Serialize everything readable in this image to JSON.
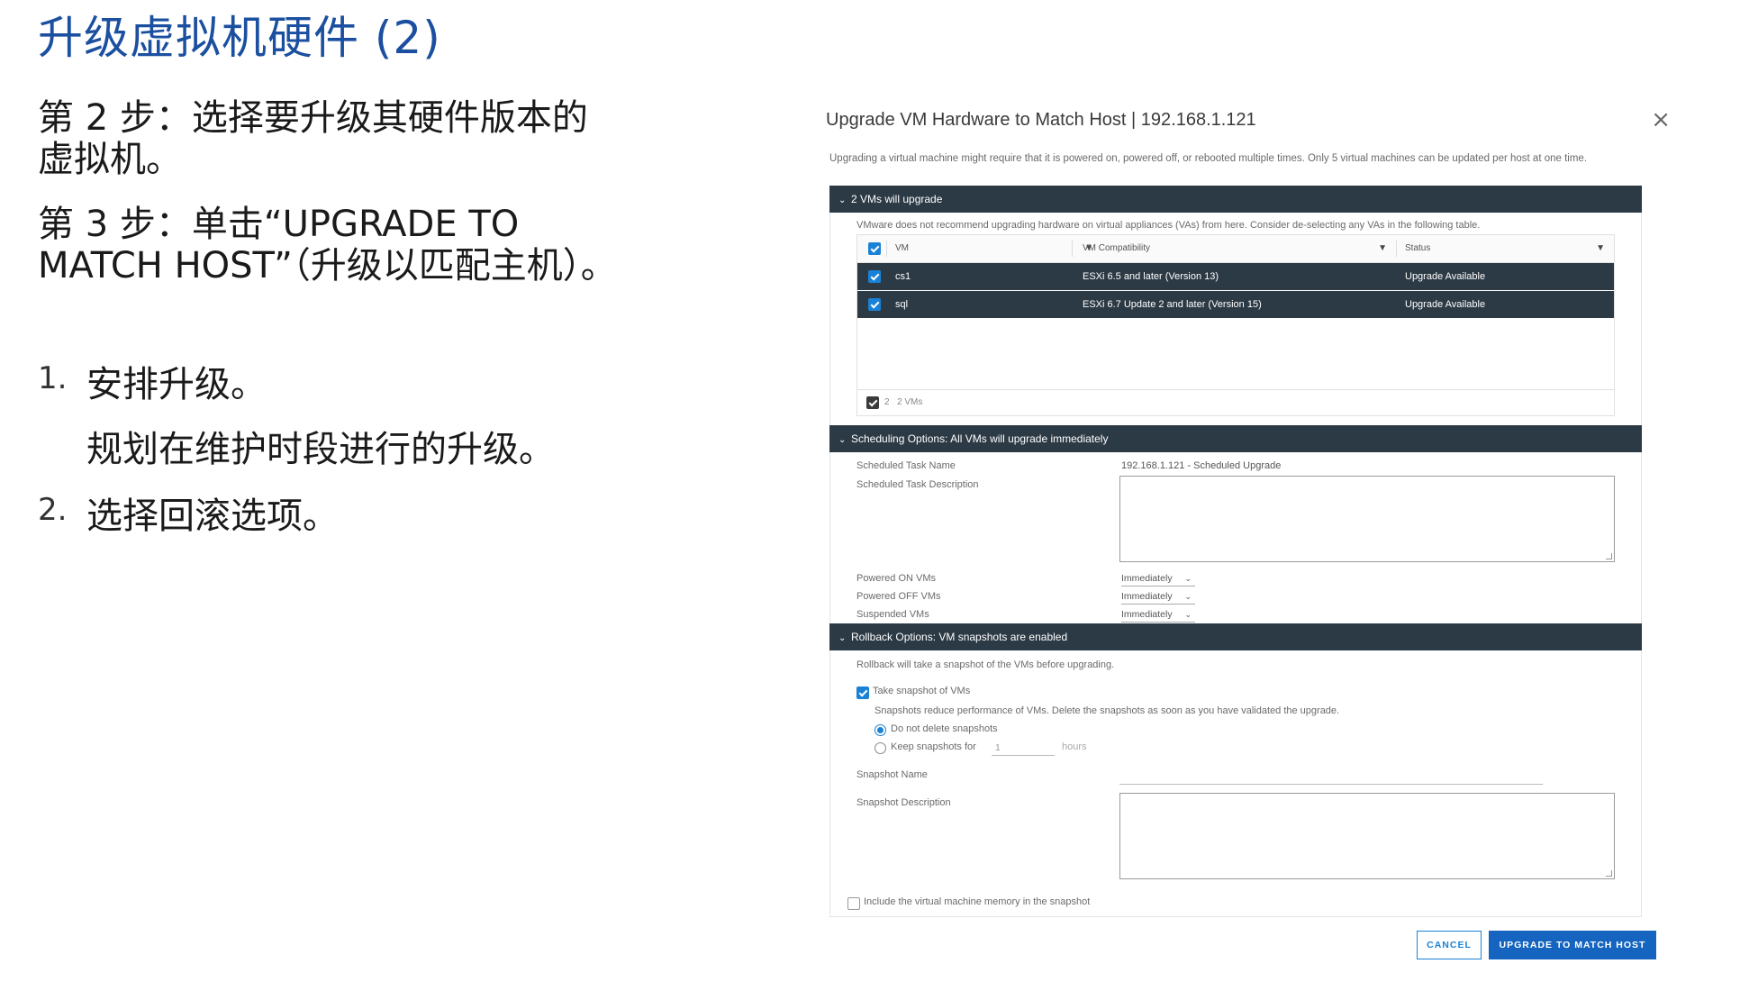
{
  "slide": {
    "title": "升级虚拟机硬件 (2)",
    "step2": "第 2 步：选择要升级其硬件版本的虚拟机。",
    "step3": "第 3 步：单击“UPGRADE TO MATCH HOST”（升级以匹配主机）。",
    "list": [
      {
        "num": "1.",
        "text": "安排升级。",
        "sub": "规划在维护时段进行的升级。"
      },
      {
        "num": "2.",
        "text": "选择回滚选项。"
      }
    ]
  },
  "dialog": {
    "title": "Upgrade VM Hardware to Match Host | 192.168.1.121",
    "close": "×",
    "intro": "Upgrading a virtual machine might require that it is powered on, powered off, or rebooted multiple times. Only 5 virtual machines can be updated per host at one time.",
    "section_vms": {
      "header": "2 VMs will upgrade",
      "note": "VMware does not recommend upgrading hardware on virtual appliances (VAs) from here. Consider de-selecting any VAs in the following table.",
      "columns": [
        "VM",
        "VM Compatibility",
        "Status"
      ],
      "rows": [
        {
          "vm": "cs1",
          "compatibility": "ESXi 6.5 and later (Version 13)",
          "status": "Upgrade Available"
        },
        {
          "vm": "sql",
          "compatibility": "ESXi 6.7 Update 2 and later (Version 15)",
          "status": "Upgrade Available"
        }
      ],
      "footer_count": "2",
      "footer_label": "2 VMs"
    },
    "section_schedule": {
      "header": "Scheduling Options: All VMs will upgrade immediately",
      "task_name_label": "Scheduled Task Name",
      "task_name_value": "192.168.1.121 - Scheduled Upgrade",
      "task_desc_label": "Scheduled Task Description",
      "powered_on_label": "Powered ON VMs",
      "powered_off_label": "Powered OFF VMs",
      "suspended_label": "Suspended VMs",
      "powered_on_value": "Immediately",
      "powered_off_value": "Immediately",
      "suspended_value": "Immediately"
    },
    "section_rollback": {
      "header": "Rollback Options: VM snapshots are enabled",
      "note": "Rollback will take a snapshot of the VMs before upgrading.",
      "take_snapshot_label": "Take snapshot of VMs",
      "snapshot_note": "Snapshots reduce performance of VMs. Delete the snapshots as soon as you have validated the upgrade.",
      "do_not_delete_label": "Do not delete snapshots",
      "keep_for_label": "Keep snapshots for",
      "keep_for_value": "1",
      "keep_for_unit": "hours",
      "snapshot_name_label": "Snapshot Name",
      "snapshot_desc_label": "Snapshot Description",
      "include_memory_label": "Include the virtual machine memory in the snapshot"
    },
    "buttons": {
      "cancel": "CANCEL",
      "upgrade": "UPGRADE TO MATCH HOST"
    }
  },
  "colors": {
    "title_blue": "#1b4fa0",
    "header_dark": "#2c3a45",
    "accent_blue": "#1a82d6",
    "primary_button": "#1565c0"
  }
}
